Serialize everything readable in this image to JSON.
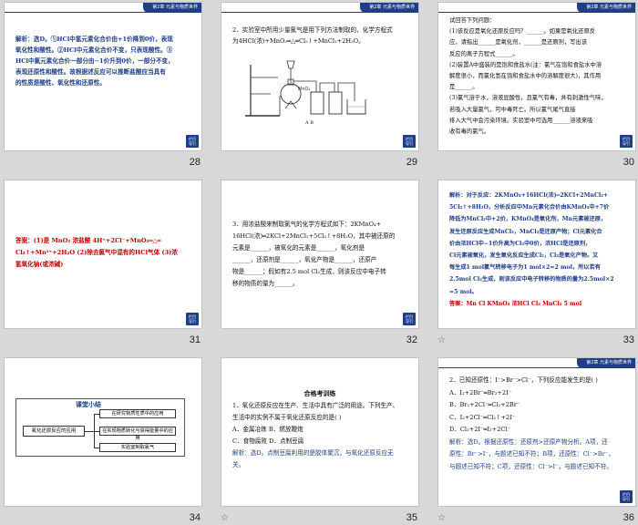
{
  "header_label": "第2章  元素与物质世界",
  "back_label_1": "栏目",
  "back_label_2": "导引",
  "slides": [
    {
      "number": "28",
      "lines": [
        "解析：选D。①HCl中氢元素化合价由+1价降到0价，表现",
        "氧化性和酸性。②HCl中元素化合价不变，只表现酸性。③",
        "HCl中氯元素化合价一部分由−1价升到0价，一部分不变，",
        "表现还原性和酸性。故根据述反应可以推断盐酸应当具有",
        "的性质是酸性、氧化性和还原性。"
      ]
    },
    {
      "number": "29",
      "lines": [
        "2．实验室中所用少量氯气是用下列方法制取的，化学方程式",
        "为4HCl(浓)+MnO₂═△═Cl₂↑+MnCl₂+2H₂O。"
      ],
      "caption": "A          B"
    },
    {
      "number": "30",
      "lines": [
        "试回答下列问题：",
        "(1)该反应是氧化还原反应吗？______。如果是氧化还原反",
        "应，请指出______是氧化剂，______是还原剂，写出该",
        "反应的离子方程式______。",
        "(2)装置A中盛装的是饱和食盐水(注：氯气在饱和食盐水中溶",
        "解度很小，而氯化氢在饱和食盐水中的溶解度很大)，其作用",
        "是______。",
        "(3)氯气溶于水，溶液显酸性，且氯气有毒，并有刺激性气味，",
        "若吸入大量氯气，可中毒死亡。所以氯气尾气直接",
        "排入大气中会污染环境。实验室中可选用______溶液来吸",
        "收有毒的氯气。"
      ]
    },
    {
      "number": "31",
      "lines": [
        "答案：(1)是  MnO₂  浓盐酸  4H⁺+2Cl⁻+MnO₂═△═",
        "Cl₂↑+Mn²⁺+2H₂O  (2)除去氯气中混有的HCl气体  (3)浓",
        "氢氧化钠(或浓碱)"
      ]
    },
    {
      "number": "32",
      "lines": [
        "3．用浓盐酸来制取氯气的化学方程式如下：2KMnO₄+",
        "16HCl(浓)═2KCl+2MnCl₂+5Cl₂↑+8H₂O，其中被还原的",
        "元素是______，被氧化的元素是______，氧化剂是",
        "______，还原剂是______，氧化产物是______，还原产",
        "物是______；假如有2.5 mol Cl₂生成，则该反应中电子转",
        "移的物质的量为______。"
      ]
    },
    {
      "number": "33",
      "lines": [
        "解析：对于反应：2KMnO₄+16HCl(浓)═2KCl+2MnCl₂+",
        "5Cl₂↑+8H₂O，分析反应中Mn元素化合价由KMnO₄中+7价",
        "降低为MnCl₂中+2价，KMnO₄是氧化剂，Mn元素被还原，",
        "发生还原反应生成MnCl₂，MnCl₂是还原产物；Cl元素化合",
        "价由浓HCl中−1价升高为Cl₂中0价，浓HCl是还原剂，",
        "Cl元素被氧化，发生氧化反应生成Cl₂，Cl₂是氧化产物。又",
        "每生成1 mol氯气转移电子为1 mol×2=2 mol，所以若有",
        "2.5mol Cl₂生成，则该反应中电子转移的物质的量为2.5mol×2",
        "=5 mol。"
      ],
      "answer": "答案：Mn  Cl  KMnO₄  浓HCl  Cl₂  MnCl₂  5 mol"
    },
    {
      "number": "34",
      "summary": {
        "title": "课堂小结",
        "left": "氧化还原反应的应用",
        "items": [
          "在研究物质性质中的应用",
          "在实现物质转化与获得能量中的应用",
          "实验室制取氯气"
        ]
      }
    },
    {
      "number": "35",
      "title": "合格考训练",
      "lines": [
        "1．氧化还原反应在生产、生活中具有广泛的用途。下列生产、",
        "生活中的实例不属于氧化还原反应的是(    )",
        "A．金属冶炼              B．燃放鞭炮",
        "C．食物腐败              D．点制豆腐"
      ],
      "solution": [
        "解析：选D。点制豆腐利用的是胶体聚沉，与氧化还原反应无",
        "关。"
      ]
    },
    {
      "number": "36",
      "lines": [
        "2．已知还原性：I⁻>Br⁻>Cl⁻，下列反应能发生的是(    )",
        "A．I₂+2Br⁻═Br₂+2I⁻",
        "B．Br₂+2Cl⁻═Cl₂+2Br⁻",
        "C．I₂+2Cl⁻═Cl₂↑+2I⁻",
        "D．Cl₂+2I⁻═I₂+2Cl⁻"
      ],
      "solution": [
        "解析：选D。根据还原性：还原剂>还原产物分析。A项，还",
        "原性：Br⁻>I⁻，与题述已知不符；B项，还原性：Cl⁻>Br⁻，",
        "与题述已知不符；C项，还原性：Cl⁻>I⁻，与题述已知不符。"
      ]
    }
  ]
}
